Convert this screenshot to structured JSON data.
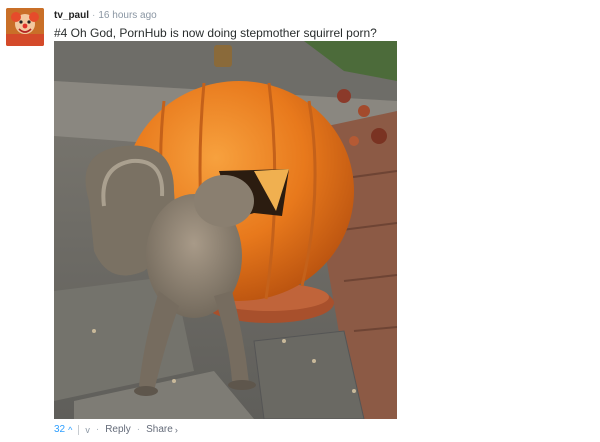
{
  "comment": {
    "username": "tv_paul",
    "separator": "·",
    "timestamp": "16 hours ago",
    "text": "#4 Oh God, PornHub is now doing stepmother squirrel porn?",
    "image_alt": "Squirrel with its head inside a carved jack-o'-lantern pumpkin"
  },
  "actions": {
    "vote_count": "32",
    "upvote_glyph": "^",
    "downvote_glyph": "v",
    "bullet": "·",
    "reply_label": "Reply",
    "share_label": "Share",
    "share_glyph": "›"
  },
  "colors": {
    "link_blue": "#2e9fff",
    "muted_text": "#656c7a",
    "username": "#222222",
    "pumpkin": "#e8791c"
  },
  "icons": {
    "avatar": "clown-avatar-icon",
    "upvote": "chevron-up-icon",
    "downvote": "chevron-down-icon",
    "share": "chevron-right-icon"
  }
}
